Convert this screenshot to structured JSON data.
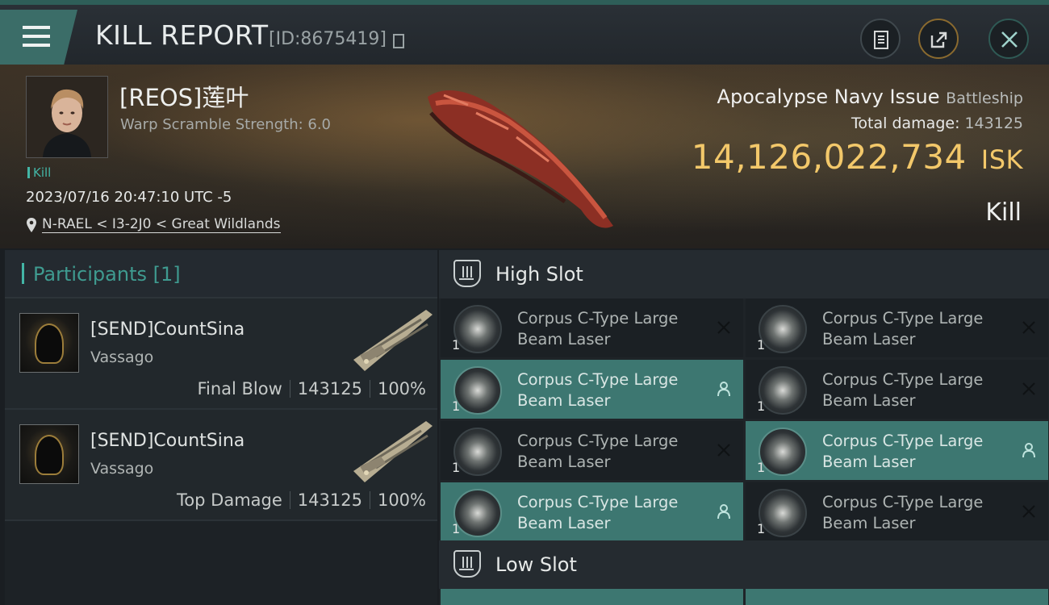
{
  "header": {
    "title": "KILL REPORT",
    "report_id": "[ID:8675419]",
    "icons": {
      "menu": "menu-icon",
      "copy": "copy-icon",
      "clipboard": "clipboard-icon",
      "share": "share-icon",
      "close": "close-icon"
    }
  },
  "victim": {
    "pilot": "[REOS]莲叶",
    "warp_scramble": "Warp Scramble Strength: 6.0",
    "kill_tag": "Kill",
    "datetime": "2023/07/16 20:47:10 UTC -5",
    "location": "N-RAEL < I3-2J0 < Great Wildlands",
    "ship_name": "Apocalypse Navy Issue",
    "ship_class": "Battleship",
    "total_damage_label": "Total damage:",
    "total_damage_value": "143125",
    "isk_value": "14,126,022,734",
    "isk_unit": "ISK",
    "result": "Kill",
    "colors": {
      "isk": "#f3c86a",
      "accent": "#43b6a6"
    }
  },
  "participants": {
    "header": "Participants [1]",
    "rows": [
      {
        "name": "[SEND]CountSina",
        "ship": "Vassago",
        "role": "Final Blow",
        "damage": "143125",
        "percent": "100%"
      },
      {
        "name": "[SEND]CountSina",
        "ship": "Vassago",
        "role": "Top Damage",
        "damage": "143125",
        "percent": "100%"
      }
    ]
  },
  "fitting": {
    "high_slot": {
      "label": "High Slot",
      "items": [
        {
          "line1": "Corpus C-Type Large",
          "line2": "Beam Laser",
          "qty": "1",
          "status": "destroyed"
        },
        {
          "line1": "Corpus C-Type Large",
          "line2": "Beam Laser",
          "qty": "1",
          "status": "destroyed"
        },
        {
          "line1": "Corpus C-Type Large",
          "line2": "Beam Laser",
          "qty": "1",
          "status": "dropped"
        },
        {
          "line1": "Corpus C-Type Large",
          "line2": "Beam Laser",
          "qty": "1",
          "status": "destroyed"
        },
        {
          "line1": "Corpus C-Type Large",
          "line2": "Beam Laser",
          "qty": "1",
          "status": "destroyed"
        },
        {
          "line1": "Corpus C-Type Large",
          "line2": "Beam Laser",
          "qty": "1",
          "status": "dropped"
        },
        {
          "line1": "Corpus C-Type Large",
          "line2": "Beam Laser",
          "qty": "1",
          "status": "dropped"
        },
        {
          "line1": "Corpus C-Type Large",
          "line2": "Beam Laser",
          "qty": "1",
          "status": "destroyed"
        }
      ]
    },
    "low_slot": {
      "label": "Low Slot"
    }
  }
}
